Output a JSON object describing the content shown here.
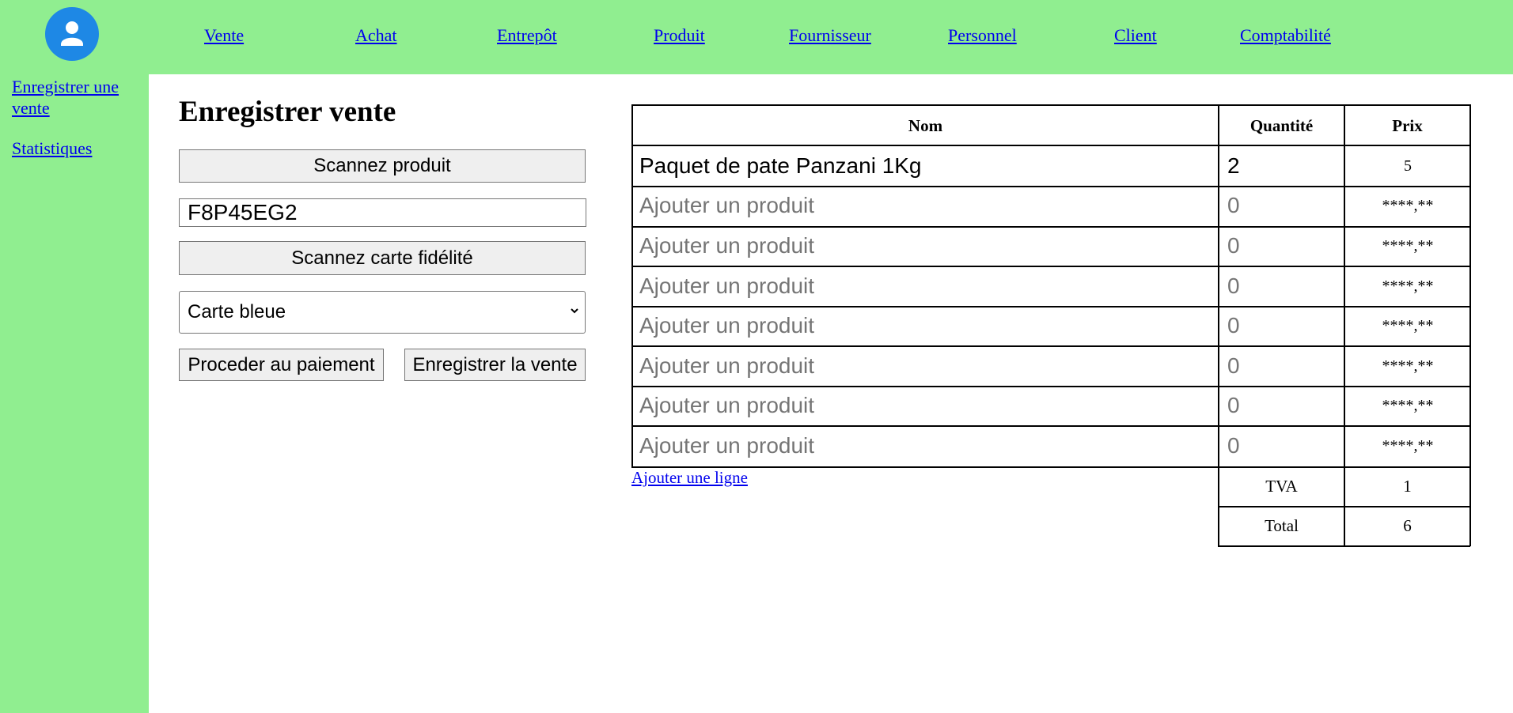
{
  "nav": {
    "items": [
      "Vente",
      "Achat",
      "Entrepôt",
      "Produit",
      "Fournisseur",
      "Personnel",
      "Client",
      "Comptabilité"
    ]
  },
  "sidebar": {
    "items": [
      "Enregistrer une vente",
      "Statistiques"
    ]
  },
  "form": {
    "title": "Enregistrer vente",
    "scan_product_label": "Scannez produit",
    "product_code_value": "F8P45EG2",
    "scan_card_label": "Scannez carte fidélité",
    "payment_selected": "Carte bleue",
    "proceed_label": "Proceder au paiement",
    "save_label": "Enregistrer la vente"
  },
  "table": {
    "headers": {
      "name": "Nom",
      "qty": "Quantité",
      "price": "Prix"
    },
    "rows": [
      {
        "name": "Paquet de pate Panzani 1Kg",
        "qty": "2",
        "price": "5"
      },
      {
        "name": "Ajouter un produit",
        "qty": "0",
        "price": "****,**"
      },
      {
        "name": "Ajouter un produit",
        "qty": "0",
        "price": "****,**"
      },
      {
        "name": "Ajouter un produit",
        "qty": "0",
        "price": "****,**"
      },
      {
        "name": "Ajouter un produit",
        "qty": "0",
        "price": "****,**"
      },
      {
        "name": "Ajouter un produit",
        "qty": "0",
        "price": "****,**"
      },
      {
        "name": "Ajouter un produit",
        "qty": "0",
        "price": "****,**"
      },
      {
        "name": "Ajouter un produit",
        "qty": "0",
        "price": "****,**"
      }
    ],
    "add_line_label": "Ajouter une ligne",
    "tva_label": "TVA",
    "tva_value": "1",
    "total_label": "Total",
    "total_value": "6"
  },
  "colors": {
    "green": "#90ee90",
    "avatar": "#1e88e5",
    "link": "#0000ee"
  },
  "icons": {
    "avatar": "user-avatar-icon",
    "select": "chevron-down-icon"
  }
}
